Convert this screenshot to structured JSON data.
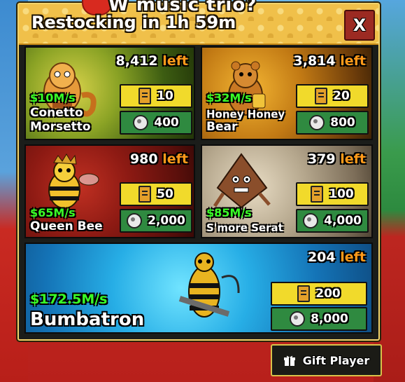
{
  "window": {
    "title_partial": "W music trio?",
    "restock_label": "Restocking in 1h 59m",
    "close_label": "X"
  },
  "items": [
    {
      "name": "Conetto Morsetto",
      "name_lines": [
        "Conetto",
        "Morsetto"
      ],
      "rate": "$10M/s",
      "stock_count": "8,412",
      "stock_suffix": "left",
      "ticket_price": "10",
      "coin_price": "400",
      "bg_color": "#5f7d15"
    },
    {
      "name": "Honey Honey Bear",
      "name_lines": [
        "Honey Honey",
        "Bear"
      ],
      "rate": "$32M/s",
      "stock_count": "3,814",
      "stock_suffix": "left",
      "ticket_price": "20",
      "coin_price": "800",
      "bg_color": "#9c5a10"
    },
    {
      "name": "Queen Bee",
      "name_lines": [
        "Queen Bee"
      ],
      "rate": "$65M/s",
      "stock_count": "980",
      "stock_suffix": "left",
      "ticket_price": "50",
      "coin_price": "2,000",
      "bg_color": "#8d1a13"
    },
    {
      "name": "S'more Serat",
      "name_lines": [
        "S'more Serat"
      ],
      "rate": "$85M/s",
      "stock_count": "379",
      "stock_suffix": "left",
      "ticket_price": "100",
      "coin_price": "4,000",
      "bg_color": "#9b8c74"
    },
    {
      "name": "Bumbatron",
      "name_lines": [
        "Bumbatron"
      ],
      "rate": "$172.5M/s",
      "stock_count": "204",
      "stock_suffix": "left",
      "ticket_price": "200",
      "coin_price": "8,000",
      "bg_color": "#1a8fd2"
    }
  ],
  "footer": {
    "gift_label": "Gift Player"
  },
  "colors": {
    "header_gold": "#f0c04a",
    "rate_green": "#39ff26",
    "left_orange": "#ff9a1a",
    "ticket_yellow": "#f1da2b",
    "coin_green": "#2f8a40",
    "close_red": "#9c2a22"
  },
  "icons": {
    "ticket": "ticket-icon",
    "coin": "coin-icon",
    "gift": "gift-icon",
    "close": "close-icon"
  }
}
